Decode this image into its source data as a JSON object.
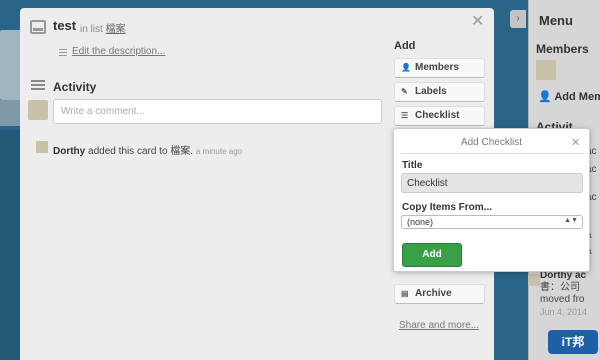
{
  "card": {
    "title": "test",
    "in_list_prefix": "in list",
    "list_name": "檔案",
    "edit_description": "Edit the description...",
    "close_glyph": "✕"
  },
  "activity": {
    "title": "Activity",
    "comment_placeholder": "Write a comment...",
    "feed": [
      {
        "user": "Dorthy",
        "action": "added this card to 檔案.",
        "time": "a minute ago"
      }
    ]
  },
  "add_section": {
    "title": "Add",
    "buttons": [
      {
        "label": "Members",
        "icon": "person-icon"
      },
      {
        "label": "Labels",
        "icon": "tag-icon"
      },
      {
        "label": "Checklist",
        "icon": "checklist-icon"
      }
    ],
    "archive_label": "Archive",
    "archive_icon": "archive-icon",
    "share_label": "Share and more..."
  },
  "popover": {
    "title": "Add Checklist",
    "close_glyph": "✕",
    "title_label": "Title",
    "title_value": "Checklist",
    "copy_label": "Copy Items From...",
    "copy_selected": "(none)",
    "add_button": "Add"
  },
  "menu": {
    "header": "Menu",
    "toggle_glyph": "›",
    "members_title": "Members",
    "add_member": "Add Membe",
    "activity_title": "Activit",
    "fragments": [
      "ac",
      "ac",
      "ac",
      "a",
      "a"
    ],
    "feed_user": "Dorthy",
    "feed_text_1": "Dorthy ac",
    "feed_text_2": "書：公司",
    "feed_text_3": "moved fro",
    "feed_time": "Jun 4, 2014"
  },
  "watermark": "iT邦",
  "colors": {
    "accent_green": "#3aa048",
    "board_blue": "#2a6587"
  }
}
